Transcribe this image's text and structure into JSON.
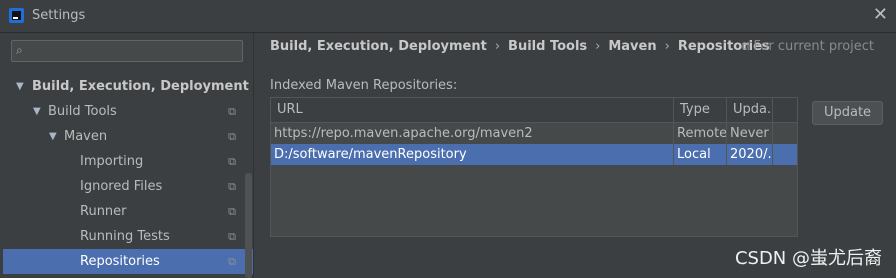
{
  "window": {
    "title": "Settings"
  },
  "sidebar": {
    "items": [
      {
        "label": "Build, Execution, Deployment",
        "level": 0,
        "expanded": true,
        "bold": true,
        "selected": false
      },
      {
        "label": "Build Tools",
        "level": 1,
        "expanded": true,
        "selected": false
      },
      {
        "label": "Maven",
        "level": 2,
        "expanded": true,
        "selected": false
      },
      {
        "label": "Importing",
        "level": 3,
        "selected": false
      },
      {
        "label": "Ignored Files",
        "level": 3,
        "selected": false
      },
      {
        "label": "Runner",
        "level": 3,
        "selected": false
      },
      {
        "label": "Running Tests",
        "level": 3,
        "selected": false
      },
      {
        "label": "Repositories",
        "level": 3,
        "selected": true
      }
    ]
  },
  "breadcrumb": [
    "Build, Execution, Deployment",
    "Build Tools",
    "Maven",
    "Repositories"
  ],
  "for_project": "For current project",
  "section_label": "Indexed Maven Repositories:",
  "table": {
    "columns": [
      "URL",
      "Type",
      "Upda..."
    ],
    "rows": [
      {
        "url": "https://repo.maven.apache.org/maven2",
        "type": "Remote",
        "updated": "Never",
        "selected": false
      },
      {
        "url": "D:/software/mavenRepository",
        "type": "Local",
        "updated": "2020/...",
        "selected": true
      }
    ]
  },
  "update_button": "Update",
  "watermark": "CSDN @蚩尤后裔"
}
